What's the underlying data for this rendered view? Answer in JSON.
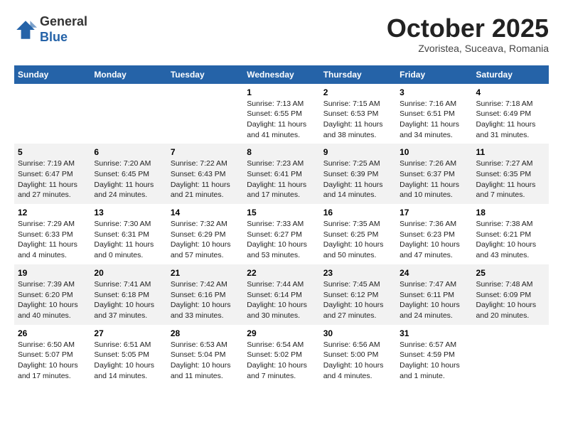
{
  "logo": {
    "general": "General",
    "blue": "Blue"
  },
  "title": "October 2025",
  "subtitle": "Zvoristea, Suceava, Romania",
  "days": [
    "Sunday",
    "Monday",
    "Tuesday",
    "Wednesday",
    "Thursday",
    "Friday",
    "Saturday"
  ],
  "weeks": [
    [
      {
        "date": "",
        "text": ""
      },
      {
        "date": "",
        "text": ""
      },
      {
        "date": "",
        "text": ""
      },
      {
        "date": "1",
        "text": "Sunrise: 7:13 AM\nSunset: 6:55 PM\nDaylight: 11 hours and 41 minutes."
      },
      {
        "date": "2",
        "text": "Sunrise: 7:15 AM\nSunset: 6:53 PM\nDaylight: 11 hours and 38 minutes."
      },
      {
        "date": "3",
        "text": "Sunrise: 7:16 AM\nSunset: 6:51 PM\nDaylight: 11 hours and 34 minutes."
      },
      {
        "date": "4",
        "text": "Sunrise: 7:18 AM\nSunset: 6:49 PM\nDaylight: 11 hours and 31 minutes."
      }
    ],
    [
      {
        "date": "5",
        "text": "Sunrise: 7:19 AM\nSunset: 6:47 PM\nDaylight: 11 hours and 27 minutes."
      },
      {
        "date": "6",
        "text": "Sunrise: 7:20 AM\nSunset: 6:45 PM\nDaylight: 11 hours and 24 minutes."
      },
      {
        "date": "7",
        "text": "Sunrise: 7:22 AM\nSunset: 6:43 PM\nDaylight: 11 hours and 21 minutes."
      },
      {
        "date": "8",
        "text": "Sunrise: 7:23 AM\nSunset: 6:41 PM\nDaylight: 11 hours and 17 minutes."
      },
      {
        "date": "9",
        "text": "Sunrise: 7:25 AM\nSunset: 6:39 PM\nDaylight: 11 hours and 14 minutes."
      },
      {
        "date": "10",
        "text": "Sunrise: 7:26 AM\nSunset: 6:37 PM\nDaylight: 11 hours and 10 minutes."
      },
      {
        "date": "11",
        "text": "Sunrise: 7:27 AM\nSunset: 6:35 PM\nDaylight: 11 hours and 7 minutes."
      }
    ],
    [
      {
        "date": "12",
        "text": "Sunrise: 7:29 AM\nSunset: 6:33 PM\nDaylight: 11 hours and 4 minutes."
      },
      {
        "date": "13",
        "text": "Sunrise: 7:30 AM\nSunset: 6:31 PM\nDaylight: 11 hours and 0 minutes."
      },
      {
        "date": "14",
        "text": "Sunrise: 7:32 AM\nSunset: 6:29 PM\nDaylight: 10 hours and 57 minutes."
      },
      {
        "date": "15",
        "text": "Sunrise: 7:33 AM\nSunset: 6:27 PM\nDaylight: 10 hours and 53 minutes."
      },
      {
        "date": "16",
        "text": "Sunrise: 7:35 AM\nSunset: 6:25 PM\nDaylight: 10 hours and 50 minutes."
      },
      {
        "date": "17",
        "text": "Sunrise: 7:36 AM\nSunset: 6:23 PM\nDaylight: 10 hours and 47 minutes."
      },
      {
        "date": "18",
        "text": "Sunrise: 7:38 AM\nSunset: 6:21 PM\nDaylight: 10 hours and 43 minutes."
      }
    ],
    [
      {
        "date": "19",
        "text": "Sunrise: 7:39 AM\nSunset: 6:20 PM\nDaylight: 10 hours and 40 minutes."
      },
      {
        "date": "20",
        "text": "Sunrise: 7:41 AM\nSunset: 6:18 PM\nDaylight: 10 hours and 37 minutes."
      },
      {
        "date": "21",
        "text": "Sunrise: 7:42 AM\nSunset: 6:16 PM\nDaylight: 10 hours and 33 minutes."
      },
      {
        "date": "22",
        "text": "Sunrise: 7:44 AM\nSunset: 6:14 PM\nDaylight: 10 hours and 30 minutes."
      },
      {
        "date": "23",
        "text": "Sunrise: 7:45 AM\nSunset: 6:12 PM\nDaylight: 10 hours and 27 minutes."
      },
      {
        "date": "24",
        "text": "Sunrise: 7:47 AM\nSunset: 6:11 PM\nDaylight: 10 hours and 24 minutes."
      },
      {
        "date": "25",
        "text": "Sunrise: 7:48 AM\nSunset: 6:09 PM\nDaylight: 10 hours and 20 minutes."
      }
    ],
    [
      {
        "date": "26",
        "text": "Sunrise: 6:50 AM\nSunset: 5:07 PM\nDaylight: 10 hours and 17 minutes."
      },
      {
        "date": "27",
        "text": "Sunrise: 6:51 AM\nSunset: 5:05 PM\nDaylight: 10 hours and 14 minutes."
      },
      {
        "date": "28",
        "text": "Sunrise: 6:53 AM\nSunset: 5:04 PM\nDaylight: 10 hours and 11 minutes."
      },
      {
        "date": "29",
        "text": "Sunrise: 6:54 AM\nSunset: 5:02 PM\nDaylight: 10 hours and 7 minutes."
      },
      {
        "date": "30",
        "text": "Sunrise: 6:56 AM\nSunset: 5:00 PM\nDaylight: 10 hours and 4 minutes."
      },
      {
        "date": "31",
        "text": "Sunrise: 6:57 AM\nSunset: 4:59 PM\nDaylight: 10 hours and 1 minute."
      },
      {
        "date": "",
        "text": ""
      }
    ]
  ]
}
